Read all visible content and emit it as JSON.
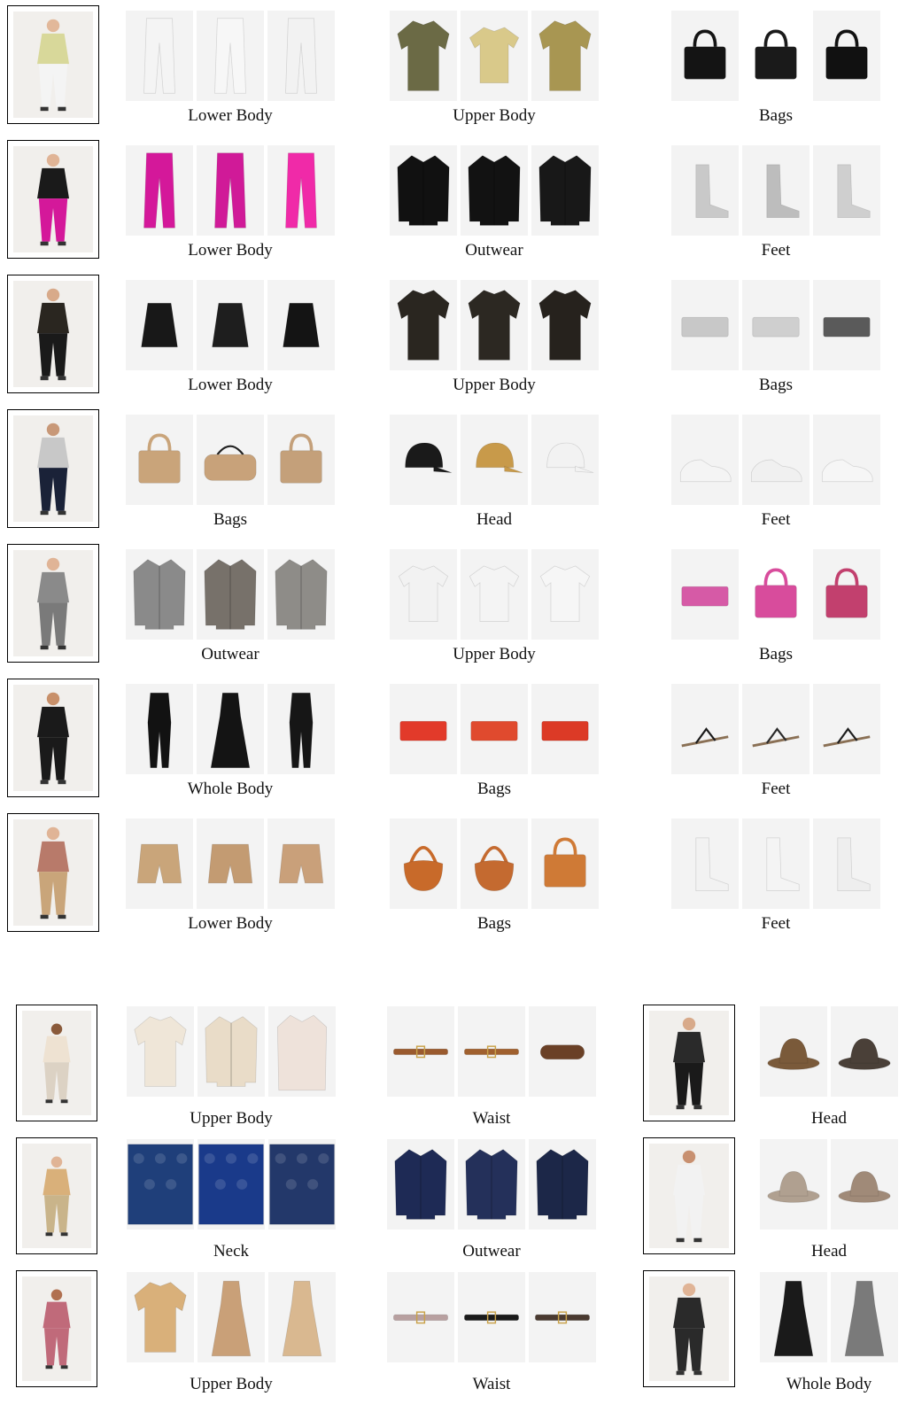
{
  "top_rows": [
    {
      "groups": [
        {
          "label": "Lower Body",
          "items": [
            {
              "shape": "pants",
              "color": "#f4f4f4"
            },
            {
              "shape": "pants",
              "color": "#f7f7f7"
            },
            {
              "shape": "pants",
              "color": "#f2f2f2"
            }
          ]
        },
        {
          "label": "Upper Body",
          "items": [
            {
              "shape": "shirt",
              "color": "#6b6a45"
            },
            {
              "shape": "tee",
              "color": "#d9c98a"
            },
            {
              "shape": "shirt",
              "color": "#a89652"
            }
          ]
        },
        {
          "label": "Bags",
          "items": [
            {
              "shape": "bag",
              "color": "#141414"
            },
            {
              "shape": "bag",
              "color": "#1a1a1a"
            },
            {
              "shape": "bag",
              "color": "#111111"
            }
          ]
        }
      ]
    },
    {
      "groups": [
        {
          "label": "Lower Body",
          "items": [
            {
              "shape": "pants",
              "color": "#d4189a"
            },
            {
              "shape": "pants",
              "color": "#d01a98"
            },
            {
              "shape": "pants",
              "color": "#f02aa8"
            }
          ]
        },
        {
          "label": "Outwear",
          "items": [
            {
              "shape": "jacket",
              "color": "#111111"
            },
            {
              "shape": "jacket",
              "color": "#121212"
            },
            {
              "shape": "jacket",
              "color": "#181818"
            }
          ]
        },
        {
          "label": "Feet",
          "items": [
            {
              "shape": "boot",
              "color": "#c9c9c9"
            },
            {
              "shape": "boot",
              "color": "#bdbdbd"
            },
            {
              "shape": "boot",
              "color": "#cfcfcf"
            }
          ]
        }
      ]
    },
    {
      "groups": [
        {
          "label": "Lower Body",
          "items": [
            {
              "shape": "skirt",
              "color": "#181818"
            },
            {
              "shape": "skirt",
              "color": "#1e1e1e"
            },
            {
              "shape": "skirt",
              "color": "#141414"
            }
          ]
        },
        {
          "label": "Upper Body",
          "items": [
            {
              "shape": "shirt",
              "color": "#2a2620"
            },
            {
              "shape": "shirt",
              "color": "#2c2822"
            },
            {
              "shape": "shirt",
              "color": "#26221d"
            }
          ]
        },
        {
          "label": "Bags",
          "items": [
            {
              "shape": "clutch",
              "color": "#c8c8c8"
            },
            {
              "shape": "clutch",
              "color": "#cfcfcf"
            },
            {
              "shape": "clutch",
              "color": "#5a5a5a"
            }
          ]
        }
      ]
    },
    {
      "groups": [
        {
          "label": "Bags",
          "items": [
            {
              "shape": "bag",
              "color": "#c9a47a"
            },
            {
              "shape": "duffel",
              "color": "#c8a27a"
            },
            {
              "shape": "bag",
              "color": "#c4a07a"
            }
          ]
        },
        {
          "label": "Head",
          "items": [
            {
              "shape": "cap",
              "color": "#1a1a1a"
            },
            {
              "shape": "cap",
              "color": "#c89a4a"
            },
            {
              "shape": "cap",
              "color": "#f2f2f2"
            }
          ]
        },
        {
          "label": "Feet",
          "items": [
            {
              "shape": "sneaker",
              "color": "#f4f4f4"
            },
            {
              "shape": "sneaker",
              "color": "#f0f0f0"
            },
            {
              "shape": "sneaker",
              "color": "#f6f6f6"
            }
          ]
        }
      ]
    },
    {
      "groups": [
        {
          "label": "Outwear",
          "items": [
            {
              "shape": "jacket",
              "color": "#8a8a8a"
            },
            {
              "shape": "jacket",
              "color": "#77716a"
            },
            {
              "shape": "jacket",
              "color": "#8e8c88"
            }
          ]
        },
        {
          "label": "Upper Body",
          "items": [
            {
              "shape": "tee",
              "color": "#f2f2f2"
            },
            {
              "shape": "tee",
              "color": "#f4f4f4"
            },
            {
              "shape": "tee",
              "color": "#f6f6f6"
            }
          ]
        },
        {
          "label": "Bags",
          "items": [
            {
              "shape": "clutch",
              "color": "#d65aa6"
            },
            {
              "shape": "bag",
              "color": "#d84c9c"
            },
            {
              "shape": "bag",
              "color": "#c2406e"
            }
          ]
        }
      ]
    },
    {
      "groups": [
        {
          "label": "Whole Body",
          "items": [
            {
              "shape": "jumpsuit",
              "color": "#121212"
            },
            {
              "shape": "dress",
              "color": "#141414"
            },
            {
              "shape": "jumpsuit",
              "color": "#161616"
            }
          ]
        },
        {
          "label": "Bags",
          "items": [
            {
              "shape": "clutch",
              "color": "#e23a2a"
            },
            {
              "shape": "clutch",
              "color": "#e04a2e"
            },
            {
              "shape": "clutch",
              "color": "#dc3a26"
            }
          ]
        },
        {
          "label": "Feet",
          "items": [
            {
              "shape": "sandal",
              "color": "#1a1a1a"
            },
            {
              "shape": "sandal",
              "color": "#2a2a2a"
            },
            {
              "shape": "sandal",
              "color": "#1e1e1e"
            }
          ]
        }
      ]
    },
    {
      "groups": [
        {
          "label": "Lower Body",
          "items": [
            {
              "shape": "shorts",
              "color": "#c9a57a"
            },
            {
              "shape": "shorts",
              "color": "#c39b72"
            },
            {
              "shape": "shorts",
              "color": "#c9a07a"
            }
          ]
        },
        {
          "label": "Bags",
          "items": [
            {
              "shape": "hobo",
              "color": "#c86a2a"
            },
            {
              "shape": "hobo",
              "color": "#c46a30"
            },
            {
              "shape": "bag",
              "color": "#cf7a36"
            }
          ]
        },
        {
          "label": "Feet",
          "items": [
            {
              "shape": "boot",
              "color": "#f2f2f2"
            },
            {
              "shape": "boot",
              "color": "#f4f4f4"
            },
            {
              "shape": "boot",
              "color": "#eeeeee"
            }
          ]
        }
      ]
    }
  ],
  "bottom_rows": [
    {
      "groups": [
        {
          "label": "Upper Body",
          "items": [
            {
              "shape": "shirt",
              "color": "#efe6d8"
            },
            {
              "shape": "jacket",
              "color": "#e9dcc8"
            },
            {
              "shape": "coat",
              "color": "#eee2da"
            }
          ]
        },
        {
          "label": "Waist",
          "items": [
            {
              "shape": "belt",
              "color": "#9a5a2e"
            },
            {
              "shape": "belt",
              "color": "#a0602e"
            },
            {
              "shape": "bracelet",
              "color": "#6a4026"
            }
          ]
        },
        {
          "label": "Head",
          "items": [
            {
              "shape": "hat",
              "color": "#7a5a3a"
            },
            {
              "shape": "hat",
              "color": "#4a4038"
            }
          ]
        }
      ]
    },
    {
      "groups": [
        {
          "label": "Neck",
          "items": [
            {
              "shape": "scarf",
              "color": "#1f3f7a"
            },
            {
              "shape": "scarf",
              "color": "#1a3a8a"
            },
            {
              "shape": "scarf",
              "color": "#23386a"
            }
          ]
        },
        {
          "label": "Outwear",
          "items": [
            {
              "shape": "jacket",
              "color": "#1e2a55"
            },
            {
              "shape": "jacket",
              "color": "#24305a"
            },
            {
              "shape": "jacket",
              "color": "#1c2748"
            }
          ]
        },
        {
          "label": "Head",
          "items": [
            {
              "shape": "hat",
              "color": "#b0a090"
            },
            {
              "shape": "hat",
              "color": "#a08a78"
            }
          ]
        }
      ]
    },
    {
      "groups": [
        {
          "label": "Upper Body",
          "items": [
            {
              "shape": "shirt",
              "color": "#d9b07a"
            },
            {
              "shape": "dress",
              "color": "#c9a078"
            },
            {
              "shape": "dress",
              "color": "#d9b890"
            }
          ]
        },
        {
          "label": "Waist",
          "items": [
            {
              "shape": "belt",
              "color": "#b8a0a0"
            },
            {
              "shape": "belt",
              "color": "#1a1a1a"
            },
            {
              "shape": "belt",
              "color": "#4a3a30"
            }
          ]
        },
        {
          "label": "Whole Body",
          "items": [
            {
              "shape": "dress",
              "color": "#1a1a1a"
            },
            {
              "shape": "dress",
              "color": "#7a7a7a"
            }
          ]
        }
      ]
    }
  ],
  "query_photos": [
    {
      "top": "#d8d89a",
      "bottom": "#f4f4f4",
      "skin": "#e2b89a"
    },
    {
      "top": "#1a1a1a",
      "bottom": "#d4189a",
      "skin": "#e0b496"
    },
    {
      "top": "#2a2620",
      "bottom": "#1a1a1a",
      "skin": "#d8aa8a"
    },
    {
      "top": "#c8c8c8",
      "bottom": "#1a2238",
      "skin": "#c89878"
    },
    {
      "top": "#8a8a8a",
      "bottom": "#7a7a7a",
      "skin": "#e0b496"
    },
    {
      "top": "#1a1a1a",
      "bottom": "#1a1a1a",
      "skin": "#c8906a"
    },
    {
      "top": "#b87a6a",
      "bottom": "#c9a57a",
      "skin": "#e0b496"
    },
    {
      "top": "#eee2d2",
      "bottom": "#dcd2c4",
      "skin": "#8a5a3a"
    },
    {
      "top": "#2a2a2a",
      "bottom": "#1a1a1a",
      "skin": "#d8aa8a"
    },
    {
      "top": "#d9b07a",
      "bottom": "#c9b48a",
      "skin": "#e0b496"
    },
    {
      "top": "#f2f2f2",
      "bottom": "#f2f2f2",
      "skin": "#c89070"
    },
    {
      "top": "#c06a7a",
      "bottom": "#c06a7a",
      "skin": "#b07050"
    },
    {
      "top": "#2a2a2a",
      "bottom": "#2a2a2a",
      "skin": "#e0b496"
    }
  ]
}
